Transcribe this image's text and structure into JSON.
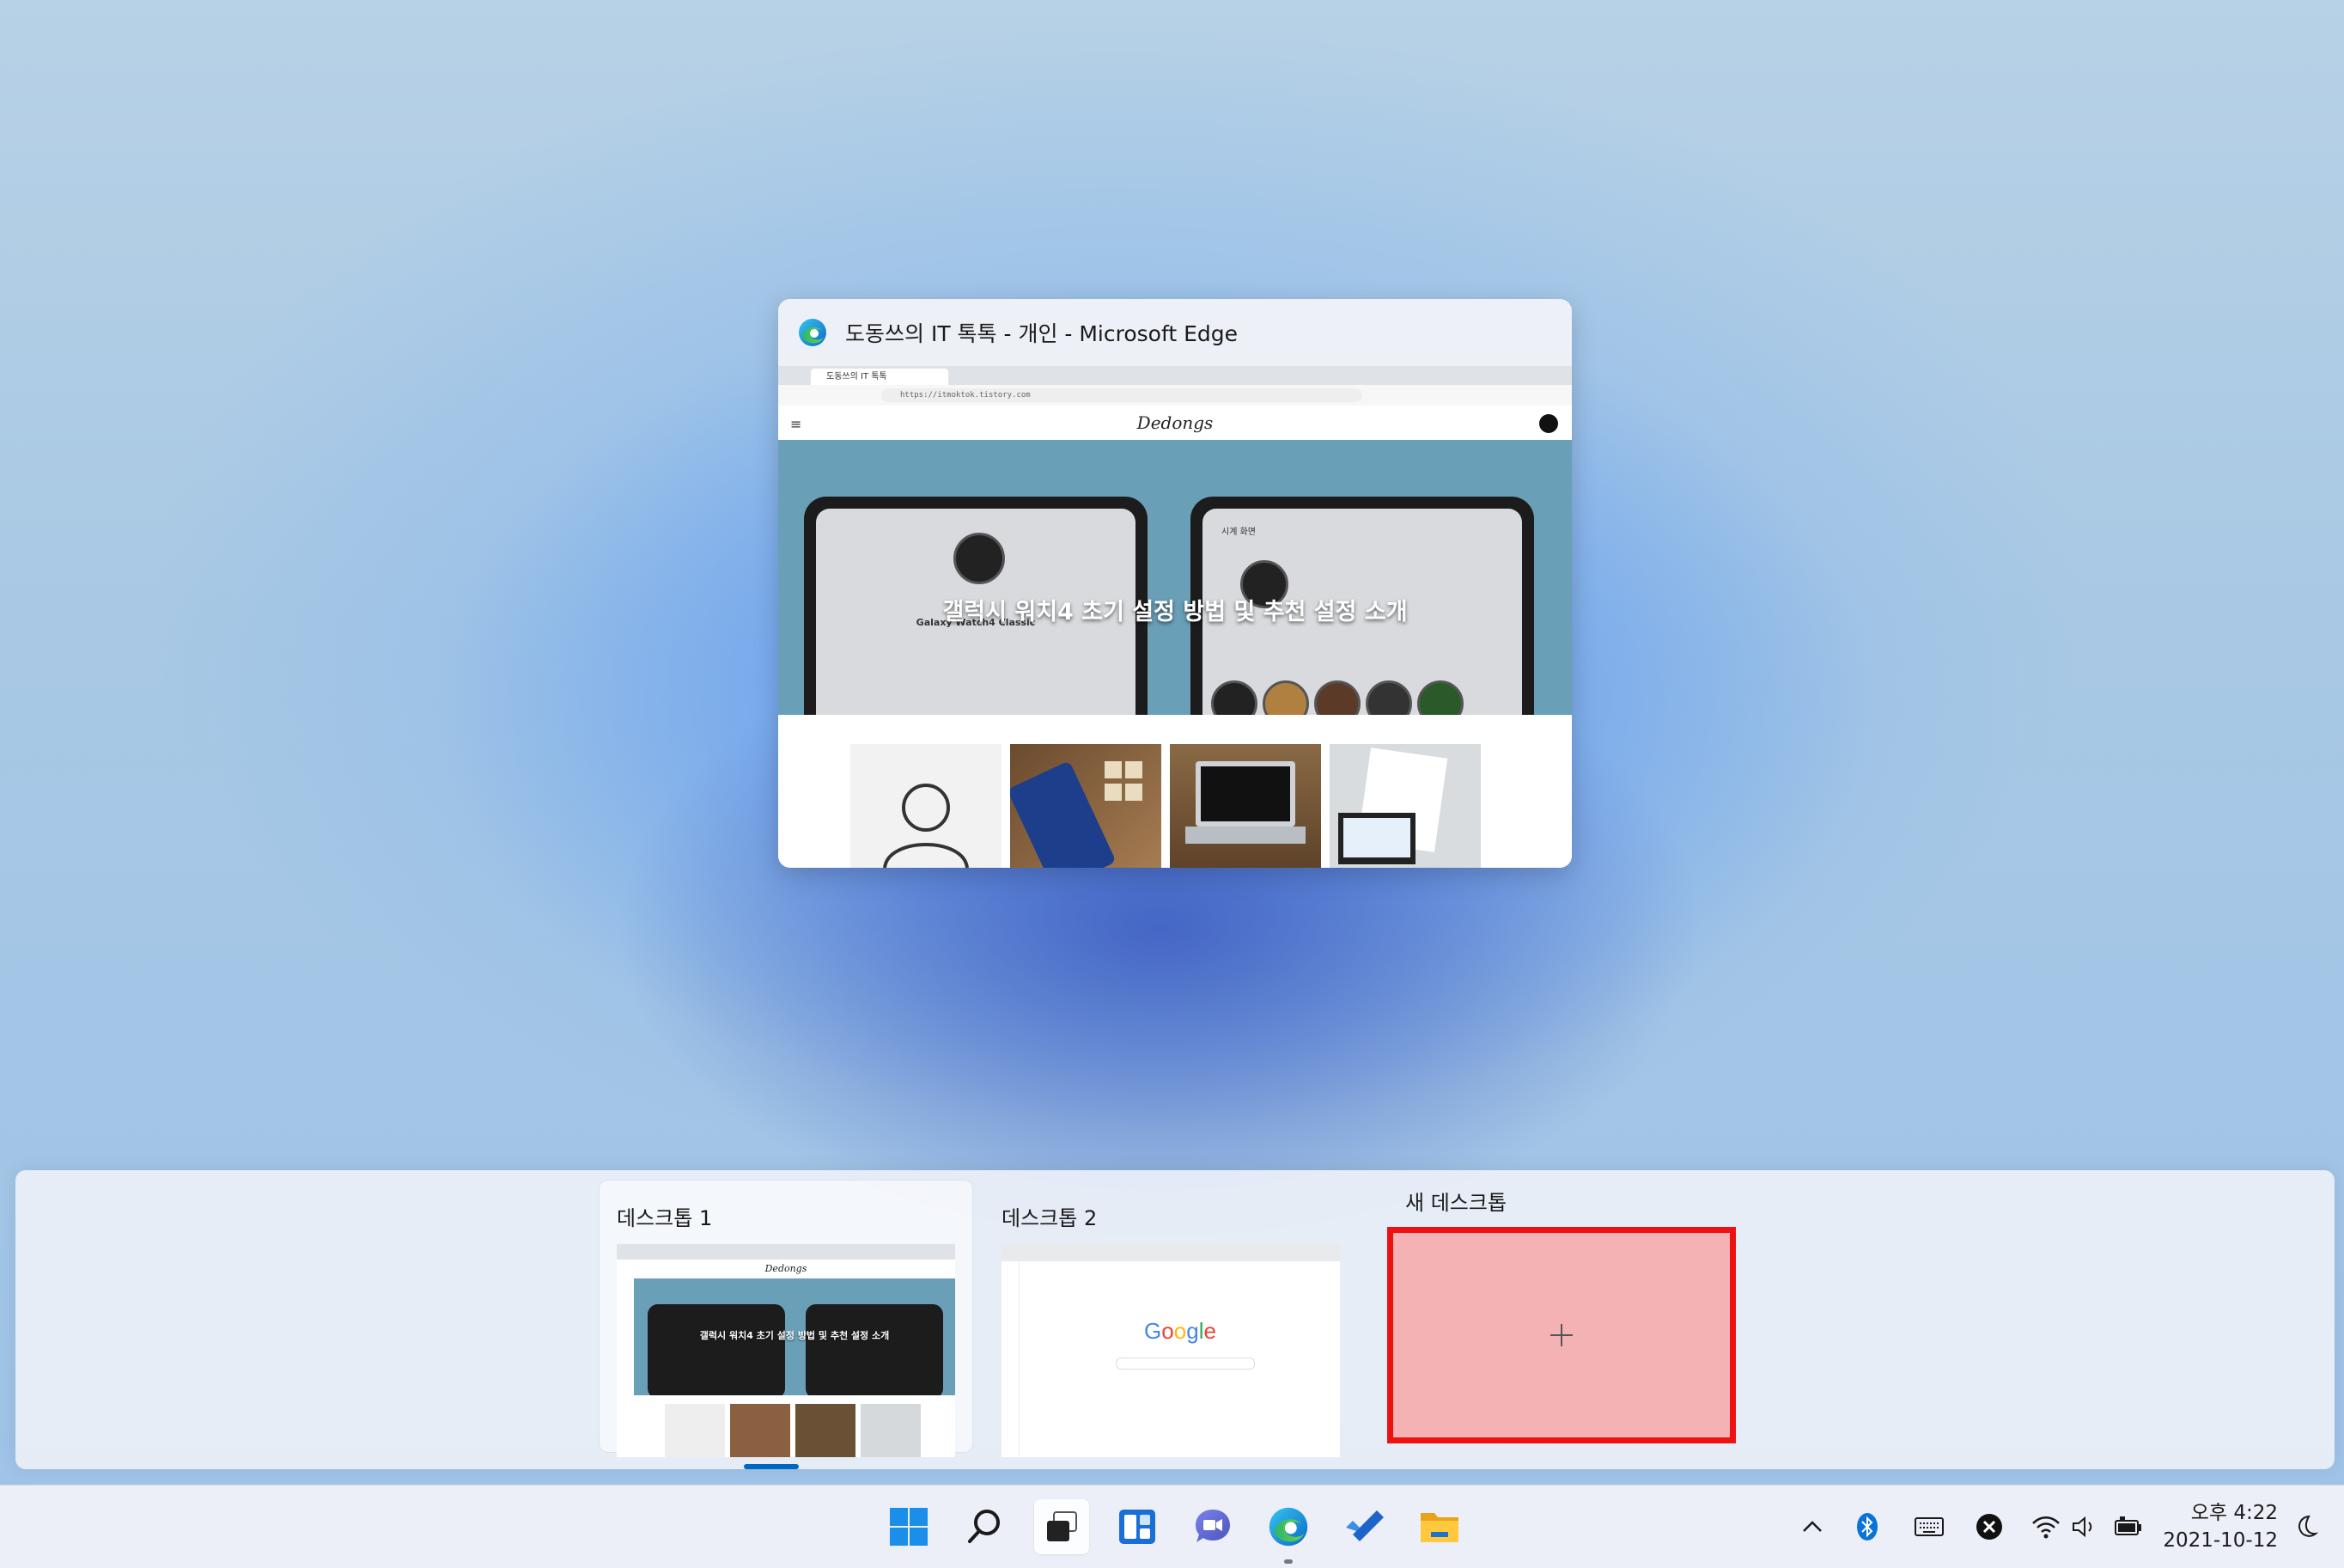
{
  "window": {
    "title": "도동쓰의 IT 톡톡 - 개인 - Microsoft Edge",
    "browser": {
      "tab_title": "도동쓰의 IT 톡톡",
      "url": "https://itmoktok.tistory.com",
      "site_logo": "Dedongs",
      "hero_title": "갤럭시 워치4 초기 설정 방법 및 추천 설정 소개",
      "watch_model": "Galaxy Watch4 Classic",
      "screen_label": "시계 화면"
    }
  },
  "virtual_desktops": {
    "desktops": [
      {
        "label": "데스크톱 1",
        "current": true
      },
      {
        "label": "데스크톱 2",
        "current": false
      }
    ],
    "new_desktop_label": "새 데스크톱",
    "new_desktop_symbol": "+",
    "desktop2_preview_text": "Google"
  },
  "taskbar": {
    "icons": [
      "windows-start-icon",
      "search-icon",
      "task-view-icon",
      "widgets-icon",
      "teams-chat-icon",
      "edge-icon",
      "todo-icon",
      "file-explorer-icon"
    ],
    "tray": [
      "chevron-up-icon",
      "bluetooth-icon",
      "keyboard-icon",
      "close-circle-icon",
      "wifi-icon",
      "speaker-icon",
      "battery-icon"
    ],
    "clock": {
      "time": "오후 4:22",
      "date": "2021-10-12"
    }
  },
  "colors": {
    "accent": "#0067c0",
    "new_desktop_border": "#ee1111",
    "new_desktop_fill": "#f4b2b5"
  }
}
